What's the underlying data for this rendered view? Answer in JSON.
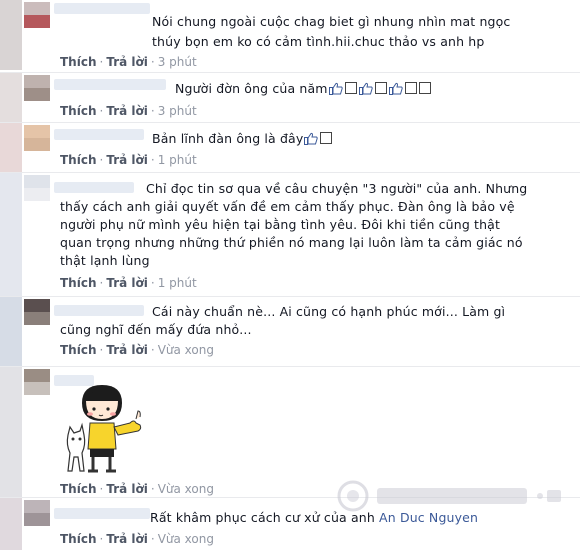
{
  "colors": {
    "link": "#3b5998",
    "meta": "#9197a3",
    "action": "#4e5665",
    "text": "#141823"
  },
  "comments": [
    {
      "text_lines": [
        "Nói chung ngoài cuộc chag biet gì nhung nhìn mat ngọc",
        "thúy bọn em ko có cảm tình.hii.chuc thảo vs anh hp"
      ],
      "like_label": "Thích",
      "reply_label": "Trả lời",
      "time": "3 phút"
    },
    {
      "text": "Người đờn ông của năm",
      "like_label": "Thích",
      "reply_label": "Trả lời",
      "time": "3 phút"
    },
    {
      "text": "Bản lĩnh đàn ông là đây",
      "like_label": "Thích",
      "reply_label": "Trả lời",
      "time": "1 phút"
    },
    {
      "text_lines": [
        "Chỉ đọc tin sơ qua về câu chuyện \"3 người\" của anh. Nhưng",
        "thấy cách anh giải quyết vấn đề em cảm thấy phục. Đàn ông là bảo vệ",
        "người phụ nữ mình yêu hiện tại bằng tình yêu. Đôi khi tiền cũng thật",
        "quan trọng nhưng những thứ phiền nó mang lại luôn làm ta cảm giác nó",
        "thật lạnh lùng"
      ],
      "like_label": "Thích",
      "reply_label": "Trả lời",
      "time": "1 phút"
    },
    {
      "text_lines": [
        "Cái này chuẩn nè... Ai cũng có hạnh phúc mới... Làm gì",
        "cũng nghĩ đến mấy đứa nhỏ..."
      ],
      "like_label": "Thích",
      "reply_label": "Trả lời",
      "time": "Vừa xong"
    },
    {
      "sticker": "girl-thumbs-up-sticker",
      "like_label": "Thích",
      "reply_label": "Trả lời",
      "time": "Vừa xong"
    },
    {
      "text": "Rất khâm phục cách cư xử của anh",
      "mention": "An Duc Nguyen",
      "like_label": "Thích",
      "reply_label": "Trả lời",
      "time": "Vừa xong"
    }
  ]
}
